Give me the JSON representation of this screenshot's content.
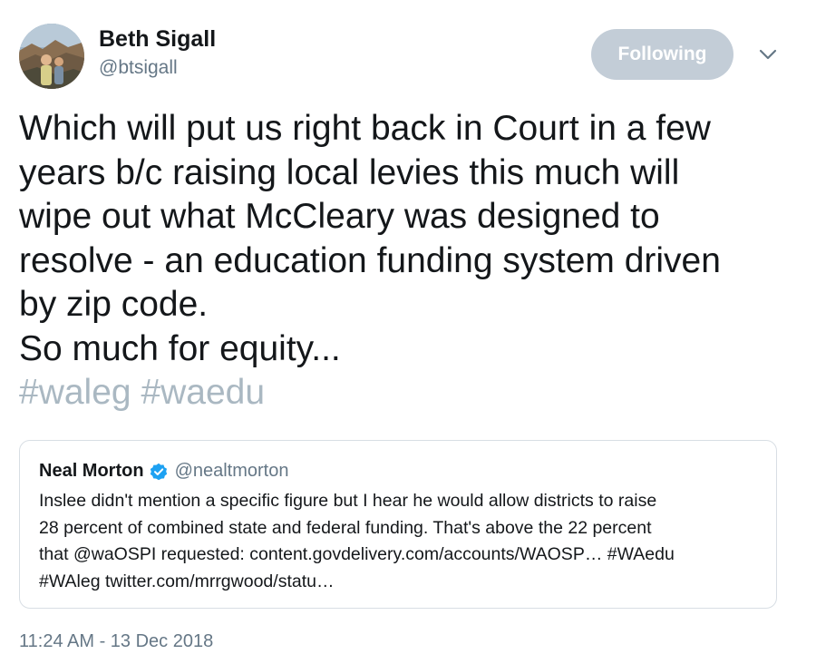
{
  "author": {
    "name": "Beth Sigall",
    "handle": "@btsigall",
    "avatar_icon": "profile-photo"
  },
  "follow_button": {
    "label": "Following",
    "color": "#c3cdd7"
  },
  "menu": {
    "icon": "chevron-down-icon"
  },
  "tweet": {
    "lines": [
      "Which will put us right back in Court in a few",
      "years b/c raising local levies this much will",
      "wipe out what McCleary was designed to",
      "resolve - an education funding system driven",
      "by zip code.",
      "So much for equity..."
    ],
    "hashtags": [
      "#waleg",
      "#waedu"
    ]
  },
  "quoted_tweet": {
    "name": "Neal Morton",
    "verified_icon": "verified-badge-icon",
    "handle": "@nealtmorton",
    "lines": [
      "Inslee didn't mention a specific figure but I hear he would allow districts to raise",
      "28 percent of combined state and federal funding. That's above the 22 percent",
      "that @waOSPI requested: content.govdelivery.com/accounts/WAOSP… #WAedu",
      "#WAleg twitter.com/mrrgwood/statu…"
    ]
  },
  "timestamp": "11:24 AM - 13 Dec 2018",
  "colors": {
    "text": "#14171a",
    "muted": "#657786",
    "hashtag": "#aab8c2",
    "verified": "#1da1f2",
    "border": "#d8dee4"
  }
}
